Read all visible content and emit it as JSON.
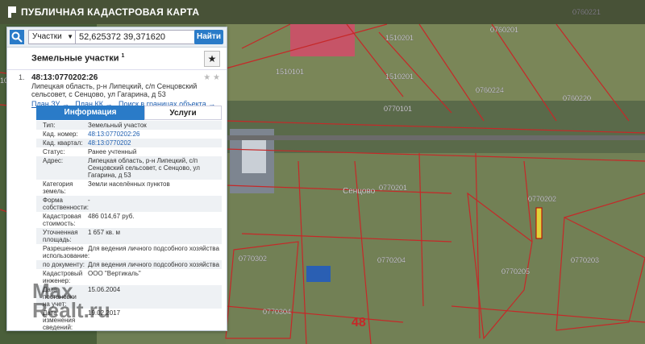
{
  "app": {
    "title": "ПУБЛИЧНАЯ КАДАСТРОВАЯ КАРТА"
  },
  "search": {
    "type_selected": "Участки",
    "value": "52,625372 39,371620",
    "button": "Найти"
  },
  "results": {
    "title": "Земельные участки",
    "count_sup": "1",
    "item_index": "1.",
    "id": "48:13:0770202:26",
    "address": "Липецкая область, р-н Липецкий, с/п Сенцовский сельсовет, с Сенцово, ул Гагарина, д 53",
    "links": [
      "План ЗУ →",
      "План КК →",
      "Поиск в границах объекта →"
    ]
  },
  "tabs": [
    "Информация",
    "Услуги"
  ],
  "props": [
    {
      "k": "Тип:",
      "v": "Земельный участок"
    },
    {
      "k": "Кад. номер:",
      "v": "48:13:0770202:26",
      "link": true
    },
    {
      "k": "Кад. квартал:",
      "v": "48:13:0770202",
      "link": true
    },
    {
      "k": "Статус:",
      "v": "Ранее учтенный"
    },
    {
      "k": "Адрес:",
      "v": "Липецкая область, р-н Липецкий, с/п Сенцовский сельсовет, с Сенцово, ул Гагарина, д 53"
    },
    {
      "k": "Категория земель:",
      "v": "Земли населённых пунктов"
    },
    {
      "k": "Форма собственности:",
      "v": "-"
    },
    {
      "k": "Кадастровая стоимость:",
      "v": "486 014,67 руб."
    },
    {
      "k": "Уточненная площадь:",
      "v": "1 657 кв. м"
    },
    {
      "k": "Разрешенное использование:",
      "v": "Для ведения личного подсобного хозяйства"
    },
    {
      "k": "по документу:",
      "v": "Для ведения личного подсобного хозяйства"
    },
    {
      "k": "Кадастровый инженер:",
      "v": "ООО \"Вертикаль\""
    },
    {
      "k": "Дата постановки на учет:",
      "v": "15.06.2004"
    },
    {
      "k": "Дата изменения сведений:",
      "v": "19.02.2017"
    },
    {
      "k": "Дата выгрузки:",
      "v": "19.02.2017"
    }
  ],
  "map_labels": {
    "q1": "1510201",
    "q2": "1510201",
    "q3": "1510101",
    "q4": "0770101",
    "q5": "0760201",
    "q6": "0760221",
    "q7": "0760224",
    "q8": "0760220",
    "q9": "0770201",
    "q10": "0770202",
    "q11": "0770204",
    "q12": "0770203",
    "q13": "0770205",
    "q14": "0770302",
    "q15": "0770304",
    "q16": "1020101",
    "village": "Сенцово",
    "region": "48"
  },
  "watermark": {
    "line1": "Max",
    "line2": "Realt.ru"
  }
}
